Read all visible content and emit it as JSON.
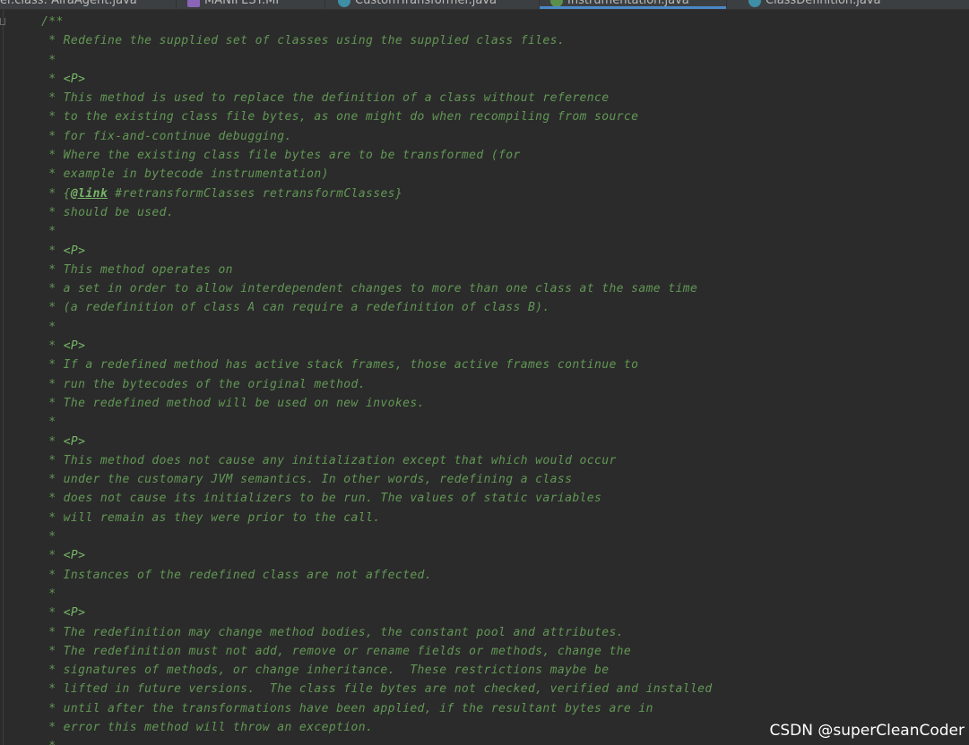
{
  "tabs": [
    {
      "label": "er.class: AiraAgent.java",
      "icon": "class-icon"
    },
    {
      "label": "MANIFEST.MF",
      "icon": "manifest-icon"
    },
    {
      "label": "CustomTransformer.java",
      "icon": "class-icon"
    },
    {
      "label": "Instrumentation.java",
      "icon": "interface-icon",
      "active": true
    },
    {
      "label": "ClassDefinition.java",
      "icon": "class-icon"
    }
  ],
  "code": {
    "open": "/**",
    "l1": " * Redefine the supplied set of classes using the supplied class files.",
    "star": " *",
    "star_prefix": " * ",
    "p_tag": "<P>",
    "l2": " * This method is used to replace the definition of a class without reference",
    "l3": " * to the existing class file bytes, as one might do when recompiling from source",
    "l4": " * for fix-and-continue debugging.",
    "l5": " * Where the existing class file bytes are to be transformed (for",
    "l6": " * example in bytecode instrumentation)",
    "l7_prefix": " * {",
    "l7_link": "@link",
    "l7_rest": " #retransformClasses retransformClasses}",
    "l8": " * should be used.",
    "l9": " * This method operates on",
    "l10": " * a set in order to allow interdependent changes to more than one class at the same time",
    "l11": " * (a redefinition of class A can require a redefinition of class B).",
    "l12": " * If a redefined method has active stack frames, those active frames continue to",
    "l13": " * run the bytecodes of the original method.",
    "l14": " * The redefined method will be used on new invokes.",
    "l15": " * This method does not cause any initialization except that which would occur",
    "l16": " * under the customary JVM semantics. In other words, redefining a class",
    "l17": " * does not cause its initializers to be run. The values of static variables",
    "l18": " * will remain as they were prior to the call.",
    "l19": " * Instances of the redefined class are not affected.",
    "l20": " * The redefinition may change method bodies, the constant pool and attributes.",
    "l21": " * The redefinition must not add, remove or rename fields or methods, change the",
    "l22": " * signatures of methods, or change inheritance.  These restrictions maybe be",
    "l23": " * lifted in future versions.  The class file bytes are not checked, verified and installed",
    "l24": " * until after the transformations have been applied, if the resultant bytes are in",
    "l25": " * error this method will throw an exception."
  },
  "watermark": "CSDN @superCleanCoder",
  "colors": {
    "background": "#2b2b2b",
    "doc_comment": "#629755",
    "doc_tag": "#77b767",
    "active_tab_underline": "#4a88c7"
  }
}
